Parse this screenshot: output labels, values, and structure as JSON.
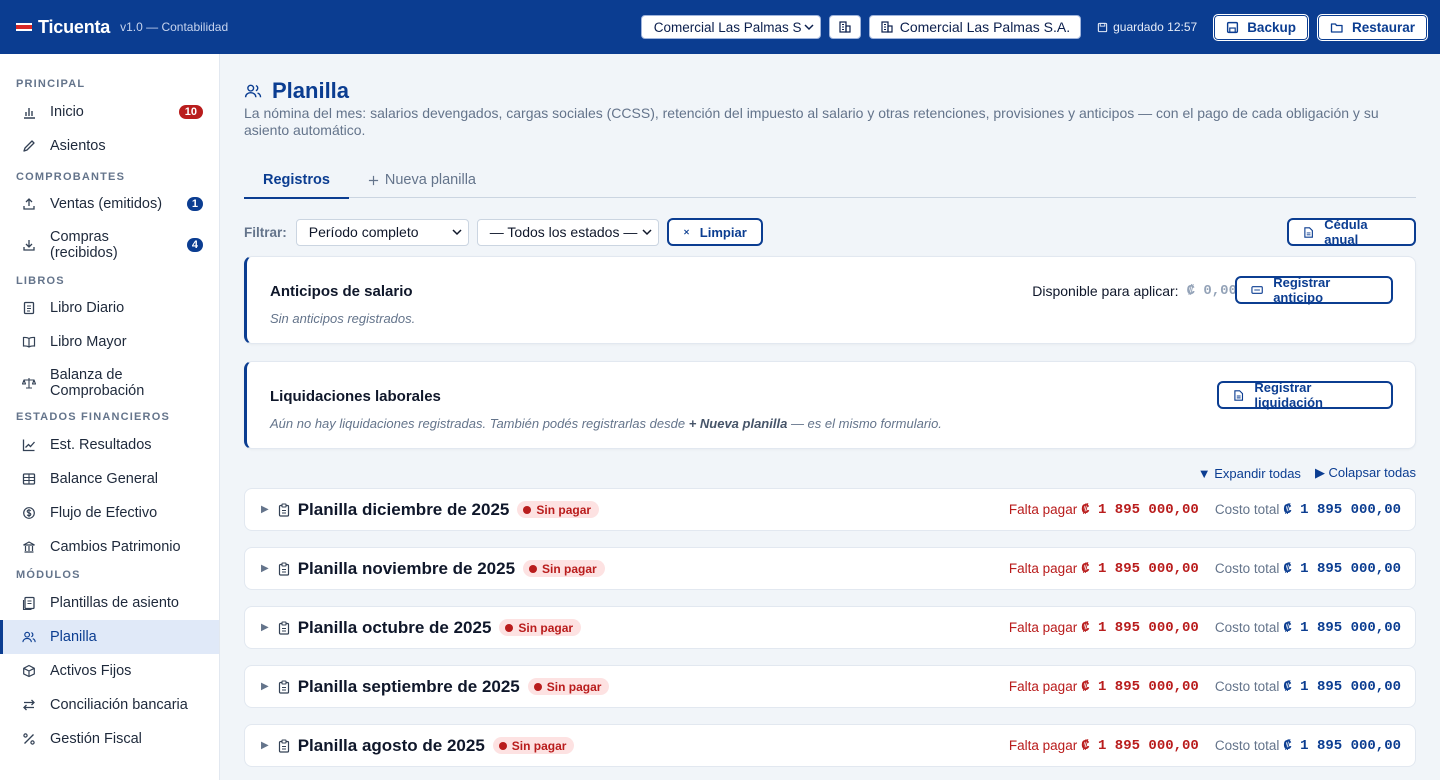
{
  "header": {
    "brand": "Ticuenta",
    "version": "v1.0 — Contabilidad",
    "company_select": "Comercial Las Palmas S.A.",
    "company_chip": "Comercial Las Palmas S.A.",
    "saved": "guardado 12:57",
    "backup": "Backup",
    "restore": "Restaurar",
    "accent_color": "#0b3d91"
  },
  "sidebar": {
    "sections": [
      {
        "title": "PRINCIPAL",
        "items": [
          {
            "label": "Inicio",
            "icon": "bar-chart-icon",
            "badge": "10"
          },
          {
            "label": "Asientos",
            "icon": "pencil-icon"
          }
        ]
      },
      {
        "title": "COMPROBANTES",
        "items": [
          {
            "label": "Ventas (emitidos)",
            "icon": "upload-icon",
            "badge": "1"
          },
          {
            "label": "Compras (recibidos)",
            "icon": "download-icon",
            "badge": "4"
          }
        ]
      },
      {
        "title": "LIBROS",
        "items": [
          {
            "label": "Libro Diario",
            "icon": "document-icon"
          },
          {
            "label": "Libro Mayor",
            "icon": "open-book-icon"
          },
          {
            "label": "Balanza de Comprobación",
            "icon": "scale-icon"
          }
        ]
      },
      {
        "title": "ESTADOS FINANCIEROS",
        "items": [
          {
            "label": "Est. Resultados",
            "icon": "line-chart-icon"
          },
          {
            "label": "Balance General",
            "icon": "table-icon"
          },
          {
            "label": "Flujo de Efectivo",
            "icon": "cash-flow-icon"
          },
          {
            "label": "Cambios Patrimonio",
            "icon": "bank-icon"
          }
        ]
      },
      {
        "title": "MÓDULOS",
        "items": [
          {
            "label": "Plantillas de asiento",
            "icon": "templates-icon"
          },
          {
            "label": "Planilla",
            "icon": "users-icon",
            "active": true
          },
          {
            "label": "Activos Fijos",
            "icon": "box-icon"
          },
          {
            "label": "Conciliación bancaria",
            "icon": "swap-icon"
          },
          {
            "label": "Gestión Fiscal",
            "icon": "percent-icon"
          }
        ]
      }
    ]
  },
  "page": {
    "title": "Planilla",
    "description": "La nómina del mes: salarios devengados, cargas sociales (CCSS), retención del impuesto al salario y otras retenciones, provisiones y anticipos — con el pago de cada obligación y su asiento automático.",
    "tabs": [
      {
        "label": "Registros",
        "active": true
      },
      {
        "label": "Nueva planilla",
        "icon": "plus-icon"
      }
    ],
    "filters": {
      "label": "Filtrar:",
      "period": "Período completo",
      "status": "— Todos los estados —",
      "clear": "Limpiar",
      "annual": "Cédula anual"
    },
    "advances": {
      "title": "Anticipos de salario",
      "empty": "Sin anticipos registrados.",
      "available_label": "Disponible para aplicar:",
      "available_value": "₡ 0,00",
      "button": "Registrar anticipo"
    },
    "settlements": {
      "title": "Liquidaciones laborales",
      "empty_a": "Aún no hay liquidaciones registradas. También podés registrarlas desde",
      "empty_link": "+ Nueva planilla",
      "empty_b": "— es el mismo formulario.",
      "button": "Registrar liquidación"
    },
    "expand_all": "▼ Expandir todas",
    "collapse_all": "▶ Colapsar todas",
    "payrolls": [
      {
        "title": "Planilla diciembre de 2025",
        "status": "Sin pagar",
        "due_label": "Falta pagar",
        "due": "₡ 1 895 000,00",
        "cost_label": "Costo total",
        "cost": "₡ 1 895 000,00"
      },
      {
        "title": "Planilla noviembre de 2025",
        "status": "Sin pagar",
        "due_label": "Falta pagar",
        "due": "₡ 1 895 000,00",
        "cost_label": "Costo total",
        "cost": "₡ 1 895 000,00"
      },
      {
        "title": "Planilla octubre de 2025",
        "status": "Sin pagar",
        "due_label": "Falta pagar",
        "due": "₡ 1 895 000,00",
        "cost_label": "Costo total",
        "cost": "₡ 1 895 000,00"
      },
      {
        "title": "Planilla septiembre de 2025",
        "status": "Sin pagar",
        "due_label": "Falta pagar",
        "due": "₡ 1 895 000,00",
        "cost_label": "Costo total",
        "cost": "₡ 1 895 000,00"
      },
      {
        "title": "Planilla agosto de 2025",
        "status": "Sin pagar",
        "due_label": "Falta pagar",
        "due": "₡ 1 895 000,00",
        "cost_label": "Costo total",
        "cost": "₡ 1 895 000,00"
      }
    ]
  }
}
